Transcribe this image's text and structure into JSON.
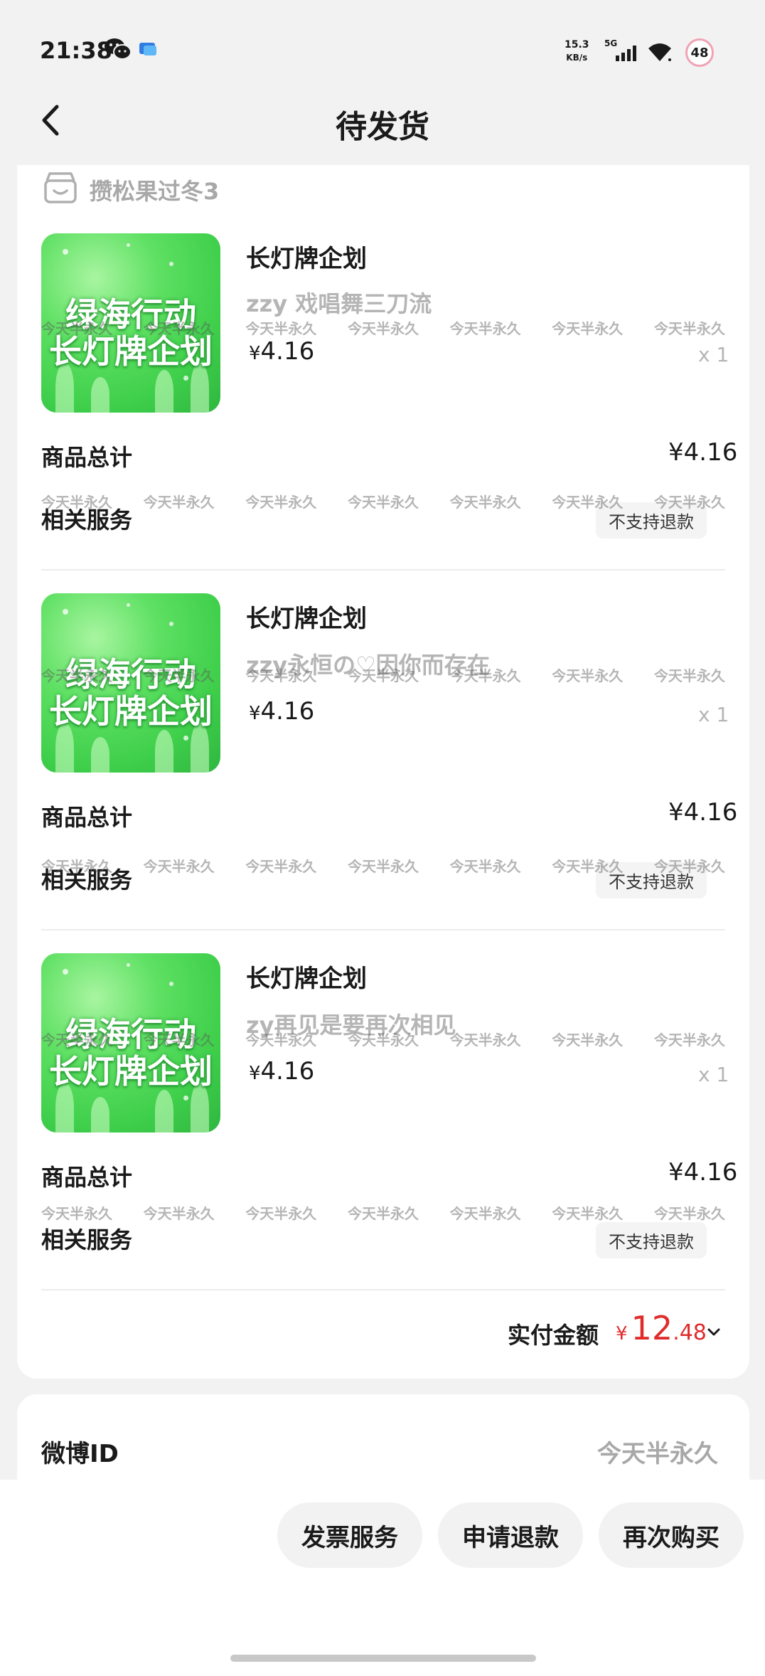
{
  "status_bar": {
    "time": "21:38",
    "net_speed_value": "15.3",
    "net_speed_unit": "KB/s",
    "signal": "5G",
    "battery": "48"
  },
  "header": {
    "title": "待发货"
  },
  "shop": {
    "name": "攒松果过冬3"
  },
  "items": [
    {
      "image_line1": "绿海行动",
      "image_line2": "长灯牌企划",
      "title": "长灯牌企划",
      "sku": "zzy 戏唱舞三刀流",
      "price_symbol": "¥",
      "price": "4.16",
      "qty": "x 1",
      "total_label": "商品总计",
      "total": "¥4.16",
      "service_label": "相关服务",
      "service_tag": "不支持退款"
    },
    {
      "image_line1": "绿海行动",
      "image_line2": "长灯牌企划",
      "title": "长灯牌企划",
      "sku": "zzy永恒の♡因你而存在",
      "price_symbol": "¥",
      "price": "4.16",
      "qty": "x 1",
      "total_label": "商品总计",
      "total": "¥4.16",
      "service_label": "相关服务",
      "service_tag": "不支持退款"
    },
    {
      "image_line1": "绿海行动",
      "image_line2": "长灯牌企划",
      "title": "长灯牌企划",
      "sku": "zy再见是要再次相见",
      "price_symbol": "¥",
      "price": "4.16",
      "qty": "x 1",
      "total_label": "商品总计",
      "total": "¥4.16",
      "service_label": "相关服务",
      "service_tag": "不支持退款"
    }
  ],
  "watermark": "今天半永久",
  "payment": {
    "label": "实付金额",
    "symbol": "¥",
    "integer": "12",
    "decimal": ".48"
  },
  "weibo": {
    "label": "微博ID",
    "value": "今天半永久"
  },
  "actions": {
    "invoice": "发票服务",
    "refund": "申请退款",
    "rebuy": "再次购买"
  },
  "colors": {
    "accent_red": "#e02b2b",
    "background": "#f2f2f2",
    "card": "#ffffff",
    "product_green": "#3fcf4b"
  }
}
